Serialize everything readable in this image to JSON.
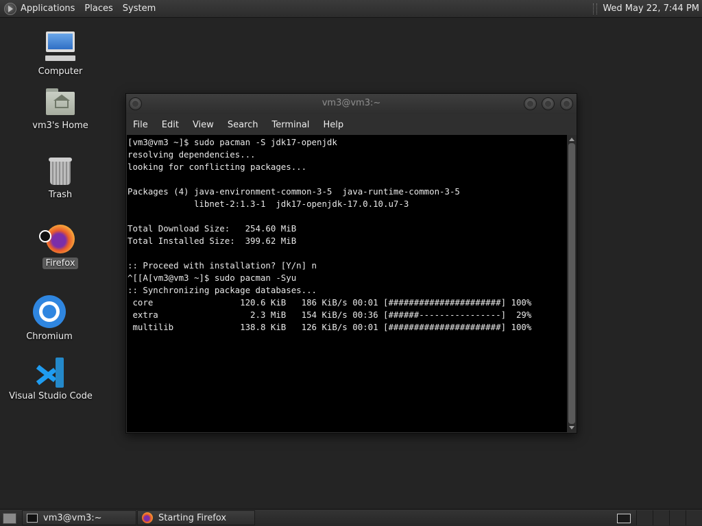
{
  "top_panel": {
    "menus": [
      "Applications",
      "Places",
      "System"
    ],
    "clock": "Wed May 22,  7:44 PM"
  },
  "desktop_icons": [
    {
      "label": "Computer",
      "icon": "computer-icon"
    },
    {
      "label": "vm3's Home",
      "icon": "home-folder-icon"
    },
    {
      "label": "Trash",
      "icon": "trash-icon"
    },
    {
      "label": "Firefox",
      "icon": "firefox-icon",
      "selected": true
    },
    {
      "label": "Chromium",
      "icon": "chromium-icon"
    },
    {
      "label": "Visual Studio Code",
      "icon": "vscode-icon"
    }
  ],
  "terminal": {
    "title": "vm3@vm3:~",
    "menu": [
      "File",
      "Edit",
      "View",
      "Search",
      "Terminal",
      "Help"
    ],
    "output": "[vm3@vm3 ~]$ sudo pacman -S jdk17-openjdk\nresolving dependencies...\nlooking for conflicting packages...\n\nPackages (4) java-environment-common-3-5  java-runtime-common-3-5\n             libnet-2:1.3-1  jdk17-openjdk-17.0.10.u7-3\n\nTotal Download Size:   254.60 MiB\nTotal Installed Size:  399.62 MiB\n\n:: Proceed with installation? [Y/n] n\n^[[A[vm3@vm3 ~]$ sudo pacman -Syu\n:: Synchronizing package databases...\n core                 120.6 KiB   186 KiB/s 00:01 [######################] 100%\n extra                  2.3 MiB   154 KiB/s 00:36 [######----------------]  29%\n multilib             138.8 KiB   126 KiB/s 00:01 [######################] 100%"
  },
  "taskbar": {
    "tasks": [
      "vm3@vm3:~",
      "Starting Firefox"
    ]
  }
}
